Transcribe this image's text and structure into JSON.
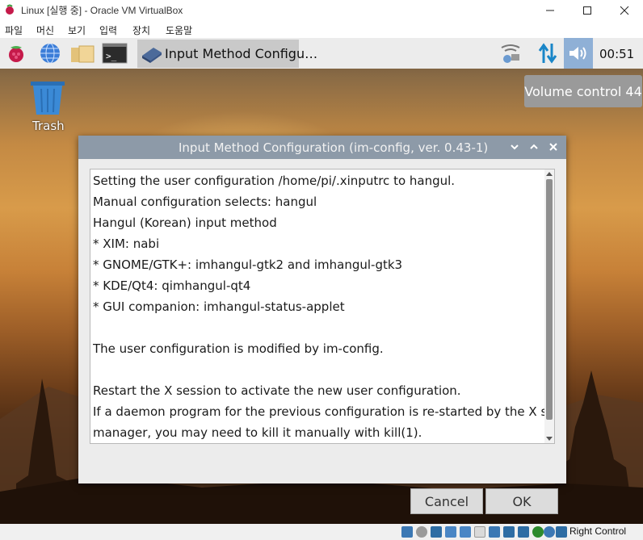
{
  "host_window": {
    "title": "Linux [실행 중] - Oracle VM VirtualBox",
    "menu": [
      "파일",
      "머신",
      "보기",
      "입력",
      "장치",
      "도움말"
    ]
  },
  "taskbar": {
    "launchers": [
      "raspberry-menu-icon",
      "web-browser-icon",
      "file-manager-icon",
      "terminal-icon"
    ],
    "task_label": "Input Method Configu…",
    "clock": "00:51"
  },
  "volume_tooltip": "Volume control 44",
  "desktop": {
    "trash_label": "Trash"
  },
  "dialog": {
    "title": "Input Method Configuration (im-config, ver. 0.43-1)",
    "lines": [
      "Setting the user configuration /home/pi/.xinputrc to hangul.",
      "Manual configuration selects: hangul",
      "Hangul (Korean) input method",
      " * XIM: nabi",
      " * GNOME/GTK+: imhangul-gtk2 and imhangul-gtk3",
      " * KDE/Qt4: qimhangul-qt4",
      " * GUI companion: imhangul-status-applet",
      "",
      "The user configuration is modified by im-config.",
      "",
      "Restart the X session to activate the new user configuration.",
      "If a daemon program for the previous configuration is re-started by the X session",
      "manager, you may need to kill it manually with kill(1)."
    ],
    "cancel_label": "Cancel",
    "ok_label": "OK"
  },
  "statusbar": {
    "right_control": "Right Control"
  }
}
